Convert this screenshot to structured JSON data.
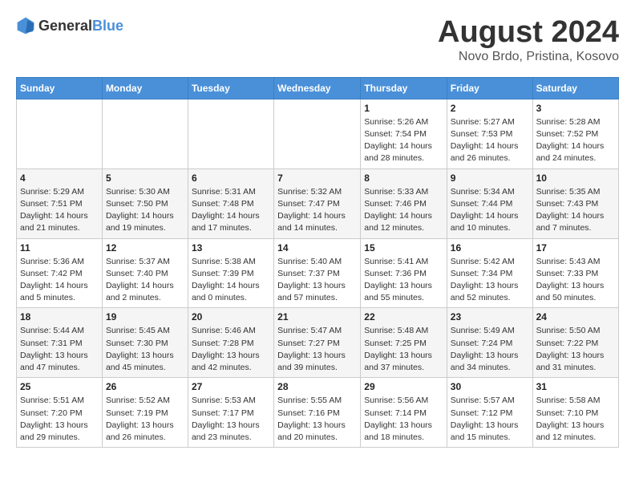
{
  "logo": {
    "general": "General",
    "blue": "Blue"
  },
  "title": "August 2024",
  "subtitle": "Novo Brdo, Pristina, Kosovo",
  "days_of_week": [
    "Sunday",
    "Monday",
    "Tuesday",
    "Wednesday",
    "Thursday",
    "Friday",
    "Saturday"
  ],
  "weeks": [
    [
      {
        "day": "",
        "info": ""
      },
      {
        "day": "",
        "info": ""
      },
      {
        "day": "",
        "info": ""
      },
      {
        "day": "",
        "info": ""
      },
      {
        "day": "1",
        "info": "Sunrise: 5:26 AM\nSunset: 7:54 PM\nDaylight: 14 hours and 28 minutes."
      },
      {
        "day": "2",
        "info": "Sunrise: 5:27 AM\nSunset: 7:53 PM\nDaylight: 14 hours and 26 minutes."
      },
      {
        "day": "3",
        "info": "Sunrise: 5:28 AM\nSunset: 7:52 PM\nDaylight: 14 hours and 24 minutes."
      }
    ],
    [
      {
        "day": "4",
        "info": "Sunrise: 5:29 AM\nSunset: 7:51 PM\nDaylight: 14 hours and 21 minutes."
      },
      {
        "day": "5",
        "info": "Sunrise: 5:30 AM\nSunset: 7:50 PM\nDaylight: 14 hours and 19 minutes."
      },
      {
        "day": "6",
        "info": "Sunrise: 5:31 AM\nSunset: 7:48 PM\nDaylight: 14 hours and 17 minutes."
      },
      {
        "day": "7",
        "info": "Sunrise: 5:32 AM\nSunset: 7:47 PM\nDaylight: 14 hours and 14 minutes."
      },
      {
        "day": "8",
        "info": "Sunrise: 5:33 AM\nSunset: 7:46 PM\nDaylight: 14 hours and 12 minutes."
      },
      {
        "day": "9",
        "info": "Sunrise: 5:34 AM\nSunset: 7:44 PM\nDaylight: 14 hours and 10 minutes."
      },
      {
        "day": "10",
        "info": "Sunrise: 5:35 AM\nSunset: 7:43 PM\nDaylight: 14 hours and 7 minutes."
      }
    ],
    [
      {
        "day": "11",
        "info": "Sunrise: 5:36 AM\nSunset: 7:42 PM\nDaylight: 14 hours and 5 minutes."
      },
      {
        "day": "12",
        "info": "Sunrise: 5:37 AM\nSunset: 7:40 PM\nDaylight: 14 hours and 2 minutes."
      },
      {
        "day": "13",
        "info": "Sunrise: 5:38 AM\nSunset: 7:39 PM\nDaylight: 14 hours and 0 minutes."
      },
      {
        "day": "14",
        "info": "Sunrise: 5:40 AM\nSunset: 7:37 PM\nDaylight: 13 hours and 57 minutes."
      },
      {
        "day": "15",
        "info": "Sunrise: 5:41 AM\nSunset: 7:36 PM\nDaylight: 13 hours and 55 minutes."
      },
      {
        "day": "16",
        "info": "Sunrise: 5:42 AM\nSunset: 7:34 PM\nDaylight: 13 hours and 52 minutes."
      },
      {
        "day": "17",
        "info": "Sunrise: 5:43 AM\nSunset: 7:33 PM\nDaylight: 13 hours and 50 minutes."
      }
    ],
    [
      {
        "day": "18",
        "info": "Sunrise: 5:44 AM\nSunset: 7:31 PM\nDaylight: 13 hours and 47 minutes."
      },
      {
        "day": "19",
        "info": "Sunrise: 5:45 AM\nSunset: 7:30 PM\nDaylight: 13 hours and 45 minutes."
      },
      {
        "day": "20",
        "info": "Sunrise: 5:46 AM\nSunset: 7:28 PM\nDaylight: 13 hours and 42 minutes."
      },
      {
        "day": "21",
        "info": "Sunrise: 5:47 AM\nSunset: 7:27 PM\nDaylight: 13 hours and 39 minutes."
      },
      {
        "day": "22",
        "info": "Sunrise: 5:48 AM\nSunset: 7:25 PM\nDaylight: 13 hours and 37 minutes."
      },
      {
        "day": "23",
        "info": "Sunrise: 5:49 AM\nSunset: 7:24 PM\nDaylight: 13 hours and 34 minutes."
      },
      {
        "day": "24",
        "info": "Sunrise: 5:50 AM\nSunset: 7:22 PM\nDaylight: 13 hours and 31 minutes."
      }
    ],
    [
      {
        "day": "25",
        "info": "Sunrise: 5:51 AM\nSunset: 7:20 PM\nDaylight: 13 hours and 29 minutes."
      },
      {
        "day": "26",
        "info": "Sunrise: 5:52 AM\nSunset: 7:19 PM\nDaylight: 13 hours and 26 minutes."
      },
      {
        "day": "27",
        "info": "Sunrise: 5:53 AM\nSunset: 7:17 PM\nDaylight: 13 hours and 23 minutes."
      },
      {
        "day": "28",
        "info": "Sunrise: 5:55 AM\nSunset: 7:16 PM\nDaylight: 13 hours and 20 minutes."
      },
      {
        "day": "29",
        "info": "Sunrise: 5:56 AM\nSunset: 7:14 PM\nDaylight: 13 hours and 18 minutes."
      },
      {
        "day": "30",
        "info": "Sunrise: 5:57 AM\nSunset: 7:12 PM\nDaylight: 13 hours and 15 minutes."
      },
      {
        "day": "31",
        "info": "Sunrise: 5:58 AM\nSunset: 7:10 PM\nDaylight: 13 hours and 12 minutes."
      }
    ]
  ]
}
